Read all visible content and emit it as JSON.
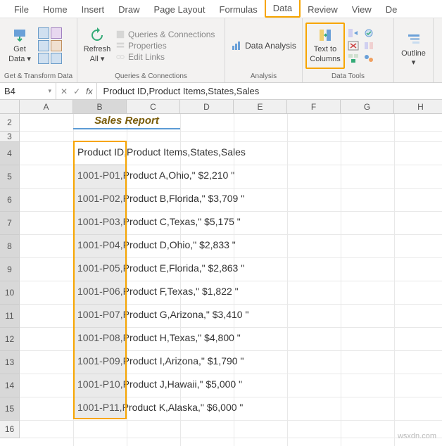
{
  "tabs": [
    "File",
    "Home",
    "Insert",
    "Draw",
    "Page Layout",
    "Formulas",
    "Data",
    "Review",
    "View",
    "De"
  ],
  "active_tab_index": 6,
  "ribbon": {
    "get_transform": {
      "label": "Get & Transform Data",
      "get_data": "Get\nData ▾"
    },
    "queries": {
      "label": "Queries & Connections",
      "refresh": "Refresh\nAll ▾",
      "qc": "Queries & Connections",
      "props": "Properties",
      "links": "Edit Links"
    },
    "analysis": {
      "label": "Analysis",
      "data_analysis": "Data Analysis"
    },
    "data_tools": {
      "label": "Data Tools",
      "text_to_cols": "Text to\nColumns"
    },
    "outline": {
      "label": "",
      "outline": "Outline\n▾"
    }
  },
  "name_box": "B4",
  "formula": "Product ID,Product Items,States,Sales",
  "columns": [
    "A",
    "B",
    "C",
    "D",
    "E",
    "F",
    "G",
    "H"
  ],
  "title": "Sales Report",
  "rows": [
    "Product ID,Product Items,States,Sales",
    "1001-P01,Product A,Ohio,\" $2,210 \"",
    "1001-P02,Product B,Florida,\" $3,709 \"",
    "1001-P03,Product C,Texas,\" $5,175 \"",
    "1001-P04,Product D,Ohio,\" $2,833 \"",
    "1001-P05,Product E,Florida,\" $2,863 \"",
    "1001-P06,Product F,Texas,\" $1,822 \"",
    "1001-P07,Product G,Arizona,\" $3,410 \"",
    "1001-P08,Product H,Texas,\" $4,800 \"",
    "1001-P09,Product I,Arizona,\" $1,790 \"",
    "1001-P10,Product J,Hawaii,\" $5,000 \"",
    "1001-P11,Product K,Alaska,\" $6,000 \""
  ],
  "watermark": "wsxdn.com"
}
